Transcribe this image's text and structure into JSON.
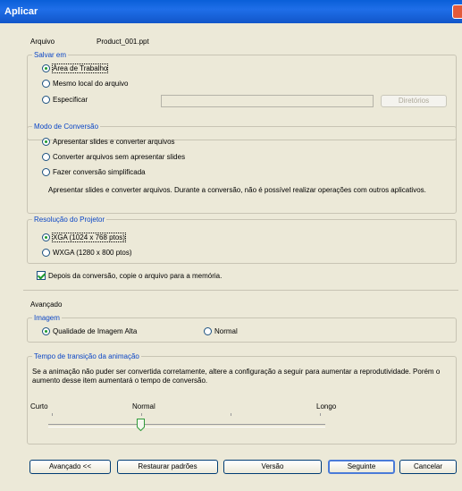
{
  "window": {
    "title": "Aplicar"
  },
  "file": {
    "label": "Arquivo",
    "name": "Product_001.ppt"
  },
  "save_in": {
    "legend": "Salvar em",
    "options": [
      "Área de Trabalho",
      "Mesmo local do arquivo",
      "Especificar"
    ],
    "selected": 0,
    "path_value": "",
    "browse_label": "Diretórios"
  },
  "conversion_mode": {
    "legend": "Modo de Conversão",
    "options": [
      "Apresentar slides e converter arquivos",
      "Converter arquivos sem apresentar slides",
      "Fazer conversão simplificada"
    ],
    "selected": 0,
    "description": "Apresentar slides e converter arquivos. Durante a conversão, não é possível realizar operações com outros aplicativos."
  },
  "resolution": {
    "legend": "Resolução do Projetor",
    "options": [
      "XGA (1024 x 768 ptos)",
      "WXGA (1280 x 800 ptos)"
    ],
    "selected": 0
  },
  "copy_to_memory": {
    "label": "Depois da conversão, copie o arquivo para a memória.",
    "checked": true
  },
  "advanced": {
    "label": "Avançado",
    "image": {
      "legend": "Imagem",
      "options": [
        "Qualidade de Imagem Alta",
        "Normal"
      ],
      "selected": 0
    },
    "transition": {
      "legend": "Tempo de transição da animação",
      "description": "Se a animação não puder ser convertida corretamente, altere a configuração a seguir para aumentar a reprodutividade. Porém o aumento desse item aumentará o tempo de conversão.",
      "labels": [
        "Curto",
        "Normal",
        "Longo"
      ],
      "slider_position": 1,
      "slider_max": 3
    }
  },
  "buttons": {
    "advanced": "Avançado <<",
    "restore": "Restaurar padrões",
    "version": "Versão",
    "next": "Seguinte",
    "cancel": "Cancelar"
  },
  "colors": {
    "accent": "#0b46c6",
    "title_bar": "#1f6ee8",
    "check_mark": "#1f9b2c",
    "dialog_bg": "#ece9d8"
  }
}
